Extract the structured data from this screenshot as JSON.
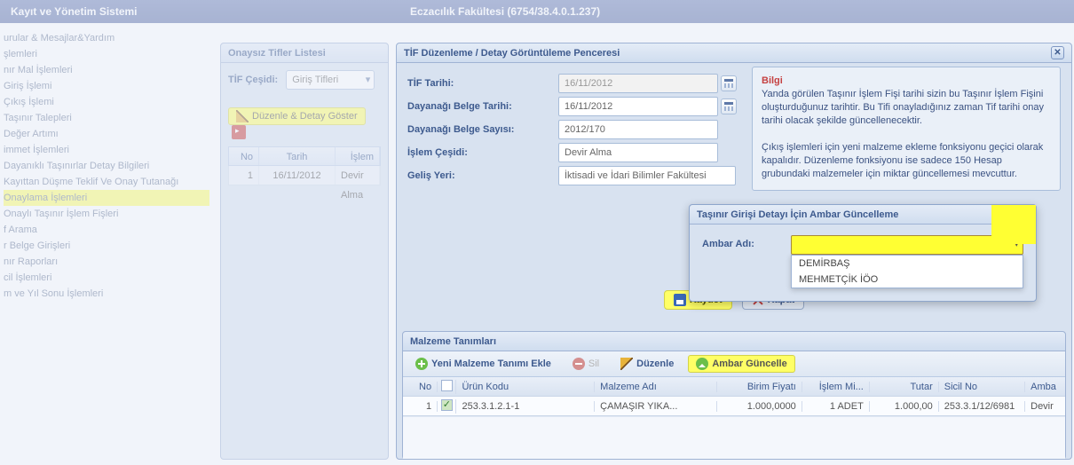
{
  "ribbon": {
    "left": "Kayıt ve Yönetim Sistemi",
    "center": "Eczacılık Fakültesi (6754/38.4.0.1.237)"
  },
  "sidebar": {
    "items": [
      "urular & Mesajlar&Yardım",
      "şlemleri",
      "nır Mal İşlemleri",
      "Giriş İşlemi",
      "Çıkış İşlemi",
      "Taşınır Talepleri",
      "Değer Artımı",
      "immet İşlemleri",
      "Dayanıklı Taşınırlar Detay Bilgileri",
      "Kayıttan Düşme Teklif Ve Onay Tutanağı",
      "Onaylama İşlemleri",
      "Onaylı Taşınır İşlem Fişleri",
      "f Arama",
      "r Belge Girişleri",
      "nır Raporları",
      "cil İşlemleri",
      "m ve Yıl Sonu İşlemleri"
    ],
    "highlight_index": 10
  },
  "tifler": {
    "title": "Onaysız Tifler Listesi",
    "cesidi_label": "TİF Çeşidi:",
    "cesidi_value": "Giriş Tifleri",
    "edit_button": "Düzenle & Detay Göster",
    "cols": {
      "no": "No",
      "tarih": "Tarih",
      "islem": "İşlem"
    },
    "row": {
      "no": "1",
      "tarih": "16/11/2012",
      "islem": "Devir Alma"
    }
  },
  "tifedit": {
    "title": "TİF Düzenleme / Detay Görüntüleme Penceresi",
    "rows": {
      "tarih_label": "TİF Tarihi:",
      "tarih_value": "16/11/2012",
      "dayanak_tarih_label": "Dayanağı Belge Tarihi:",
      "dayanak_tarih_value": "16/11/2012",
      "dayanak_sayi_label": "Dayanağı Belge Sayısı:",
      "dayanak_sayi_value": "2012/170",
      "islem_cesidi_label": "İşlem Çeşidi:",
      "islem_cesidi_value": "Devir Alma",
      "gelis_yeri_label": "Geliş Yeri:",
      "gelis_yeri_value": "İktisadi ve İdari Bilimler Fakültesi"
    },
    "info_title": "Bilgi",
    "info_p1": "Yanda görülen Taşınır İşlem Fişi tarihi sizin bu Taşınır İşlem Fişini oluşturduğunuz tarihtir. Bu Tifi onayladığınız zaman Tif tarihi onay tarihi olacak şekilde güncellenecektir.",
    "info_p2": "Çıkış işlemleri için yeni malzeme ekleme fonksiyonu geçici olarak kapalıdır. Düzenleme fonksiyonu ise sadece 150 Hesap grubundaki malzemeler için miktar güncellemesi mevcuttur.",
    "save": "Kaydet",
    "close": "Kapat"
  },
  "malzeme": {
    "title": "Malzeme Tanımları",
    "btn_add": "Yeni Malzeme Tanımı Ekle",
    "btn_del": "Sil",
    "btn_edit": "Düzenle",
    "btn_ambar": "Ambar Güncelle",
    "cols": {
      "no": "No",
      "kod": "Ürün Kodu",
      "mad": "Malzeme Adı",
      "bf": "Birim Fiyatı",
      "im": "İşlem Mi...",
      "tu": "Tutar",
      "sn": "Sicil No",
      "am": "Amba"
    },
    "row": {
      "no": "1",
      "kod": "253.3.1.2.1-1",
      "mad": "ÇAMAŞIR YIKA...",
      "bf": "1.000,0000",
      "im": "1 ADET",
      "tu": "1.000,00",
      "sn": "253.3.1/12/6981",
      "am": "Devir"
    }
  },
  "ambar": {
    "title": "Taşınır Girişi Detayı İçin Ambar Güncelleme",
    "label": "Ambar Adı:",
    "options": [
      "DEMİRBAŞ",
      "MEHMETÇİK İÖO"
    ]
  }
}
